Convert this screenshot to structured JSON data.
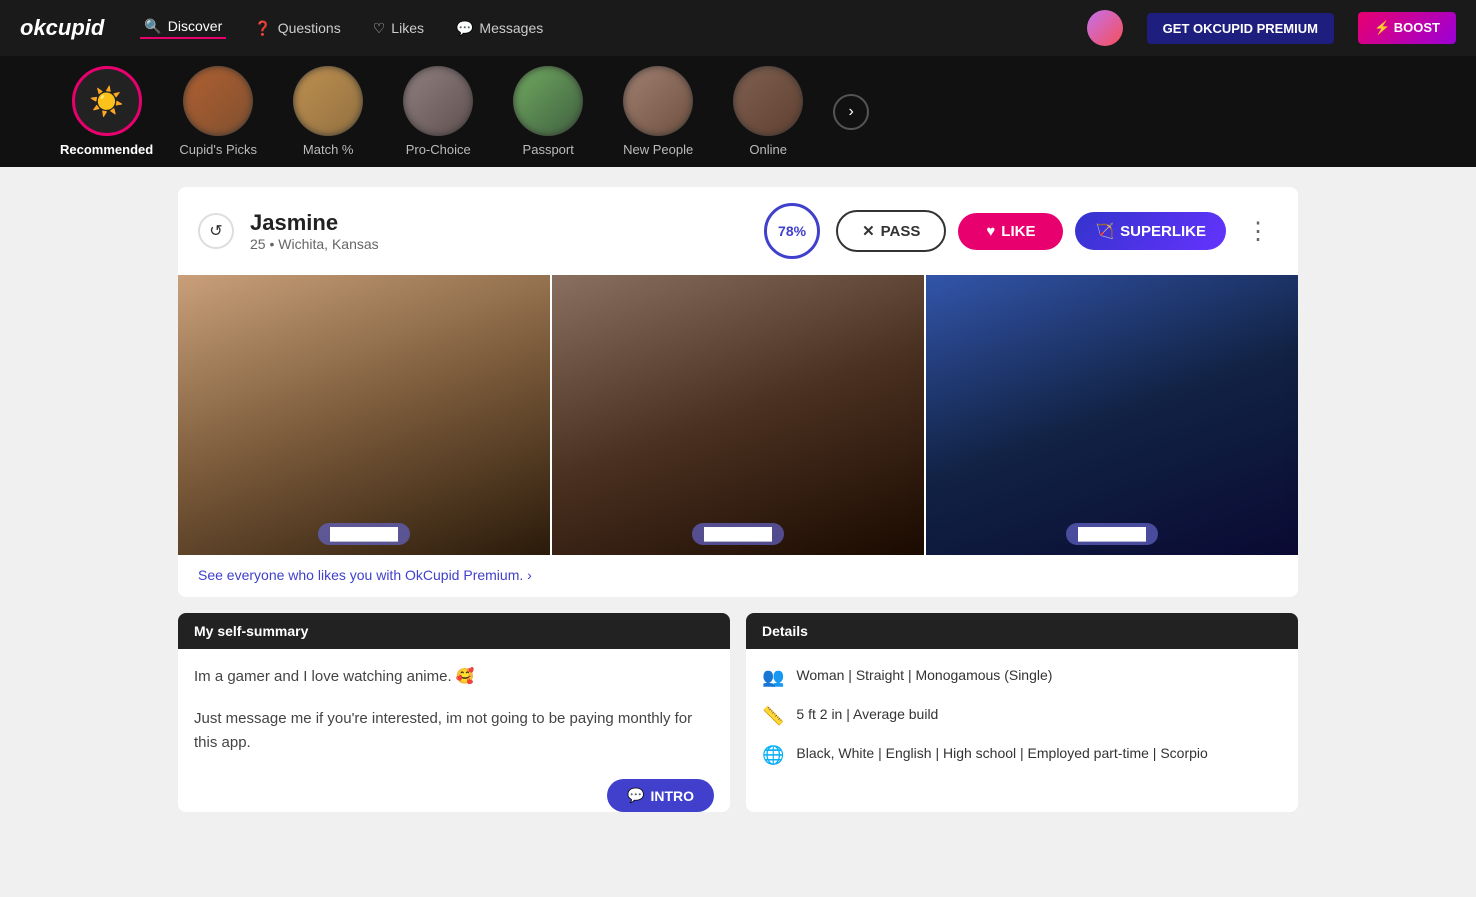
{
  "app": {
    "logo": "okcupid",
    "nav": {
      "items": [
        {
          "label": "Discover",
          "icon": "🔍",
          "active": true
        },
        {
          "label": "Questions",
          "icon": "❓",
          "active": false
        },
        {
          "label": "Likes",
          "icon": "♡",
          "active": false
        },
        {
          "label": "Messages",
          "icon": "💬",
          "active": false
        }
      ],
      "premium_btn": "GET OKCUPID PREMIUM",
      "boost_btn": "⚡ BOOST"
    }
  },
  "discover_bar": {
    "items": [
      {
        "label": "Recommended",
        "active": true,
        "icon_type": "sun"
      },
      {
        "label": "Cupid's Picks",
        "active": false,
        "icon_type": "blurred"
      },
      {
        "label": "Match %",
        "active": false,
        "icon_type": "blurred"
      },
      {
        "label": "Pro-Choice",
        "active": false,
        "icon_type": "blurred"
      },
      {
        "label": "Passport",
        "active": false,
        "icon_type": "blurred"
      },
      {
        "label": "New People",
        "active": false,
        "icon_type": "blurred"
      },
      {
        "label": "Online",
        "active": false,
        "icon_type": "blurred"
      }
    ],
    "next_btn": "›"
  },
  "profile": {
    "name": "Jasmine",
    "age": "25",
    "location": "Wichita, Kansas",
    "match_percent": "78%",
    "actions": {
      "pass": "PASS",
      "like": "LIKE",
      "superlike": "SUPERLIKE"
    },
    "premium_link": "See everyone who likes you with OkCupid Premium. ›",
    "self_summary": {
      "header": "My self-summary",
      "text1": "Im a gamer and I love watching anime. 🥰",
      "text2": "Just message me if you're interested, im not going to be paying monthly for this app.",
      "intro_btn": "INTRO"
    },
    "details": {
      "header": "Details",
      "rows": [
        {
          "icon": "👥",
          "text": "Woman | Straight | Monogamous (Single)"
        },
        {
          "icon": "📏",
          "text": "5 ft 2 in | Average build"
        },
        {
          "icon": "🌐",
          "text": "Black, White | English | High school | Employed part-time | Scorpio"
        }
      ]
    }
  }
}
